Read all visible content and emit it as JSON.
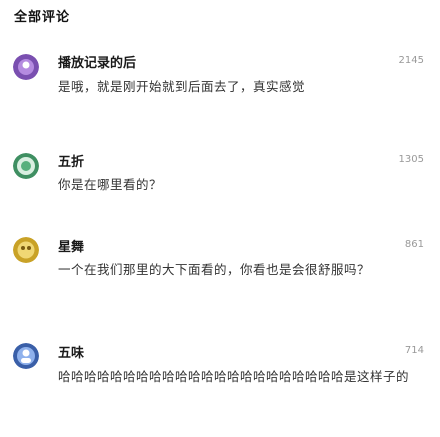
{
  "header": {
    "title": "全部评论"
  },
  "comments": [
    {
      "username": "播放记录的后",
      "likes": "2145",
      "text": "是哦，就是刚开始就到后面去了，真实感觉"
    },
    {
      "username": "五折",
      "likes": "1305",
      "text": "你是在哪里看的？"
    },
    {
      "username": "星舞",
      "likes": "861",
      "text": "一个在我们那里的大下面看的，你看也是会很舒服吗？"
    },
    {
      "username": "五味",
      "likes": "714",
      "text": "哈哈哈哈哈哈哈哈哈哈哈哈哈哈哈哈哈哈哈哈哈哈是这样子的"
    }
  ]
}
